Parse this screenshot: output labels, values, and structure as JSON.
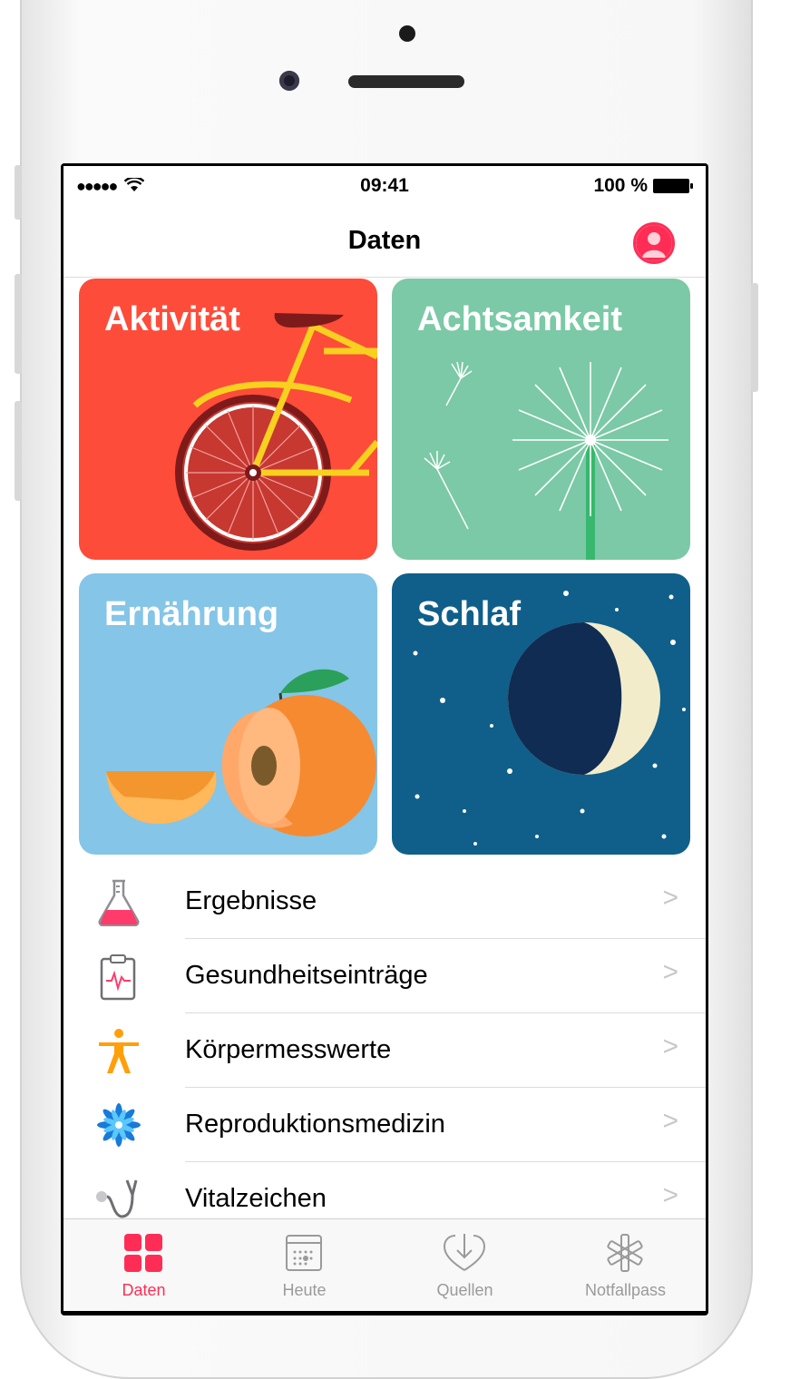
{
  "status_bar": {
    "signal": "●●●●●",
    "time": "09:41",
    "battery": "100 %"
  },
  "navbar": {
    "title": "Daten"
  },
  "tiles": [
    {
      "label": "Aktivität",
      "color": "#fd4c3a"
    },
    {
      "label": "Achtsamkeit",
      "color": "#7bc9a6"
    },
    {
      "label": "Ernährung",
      "color": "#85c5e7"
    },
    {
      "label": "Schlaf",
      "color": "#0f5f8a"
    }
  ],
  "list_items": [
    {
      "label": "Ergebnisse",
      "icon": "flask-icon"
    },
    {
      "label": "Gesundheitseinträge",
      "icon": "clipboard-icon"
    },
    {
      "label": "Körpermesswerte",
      "icon": "body-icon"
    },
    {
      "label": "Reproduktionsmedizin",
      "icon": "flower-icon"
    },
    {
      "label": "Vitalzeichen",
      "icon": "stethoscope-icon"
    }
  ],
  "tabs": [
    {
      "label": "Daten",
      "icon": "grid-icon",
      "active": true
    },
    {
      "label": "Heute",
      "icon": "calendar-icon",
      "active": false
    },
    {
      "label": "Quellen",
      "icon": "download-heart-icon",
      "active": false
    },
    {
      "label": "Notfallpass",
      "icon": "asterisk-icon",
      "active": false
    }
  ],
  "accent_color": "#ff2d55"
}
